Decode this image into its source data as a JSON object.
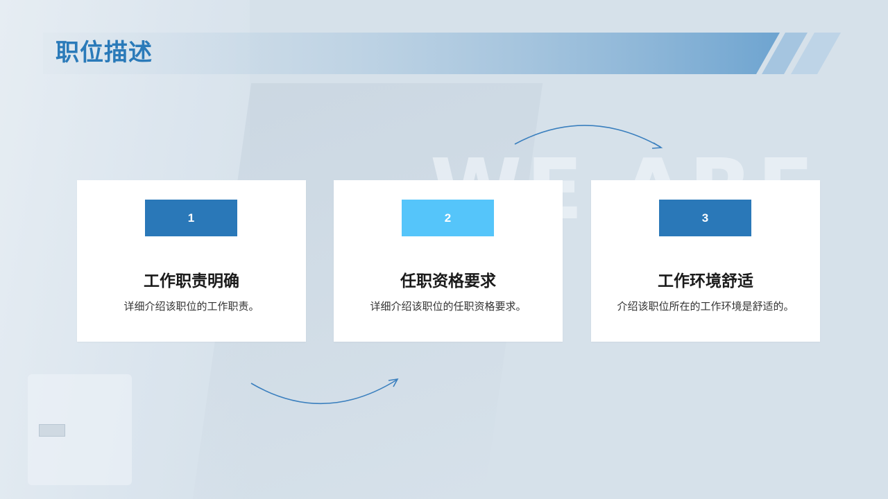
{
  "page": {
    "title": "职位描述",
    "watermark": "WE ARE"
  },
  "colors": {
    "title": "#2a7ab9",
    "band_start": "#d6e1ea",
    "band_end": "#6ea4d0",
    "badge_dark": "#2a78b8",
    "badge_light": "#55c5fa",
    "arrow": "#3a7fbe"
  },
  "cards": [
    {
      "number": "1",
      "heading": "工作职责明确",
      "description": "详细介绍该职位的工作职责。",
      "badge_color": "#2a78b8"
    },
    {
      "number": "2",
      "heading": "任职资格要求",
      "description": "详细介绍该职位的任职资格要求。",
      "badge_color": "#55c5fa"
    },
    {
      "number": "3",
      "heading": "工作环境舒适",
      "description": "介绍该职位所在的工作环境是舒适的。",
      "badge_color": "#2a78b8"
    }
  ],
  "icons": {
    "arrow_top": "curved-arrow-right-icon",
    "arrow_bottom": "curved-arrow-up-right-icon"
  }
}
